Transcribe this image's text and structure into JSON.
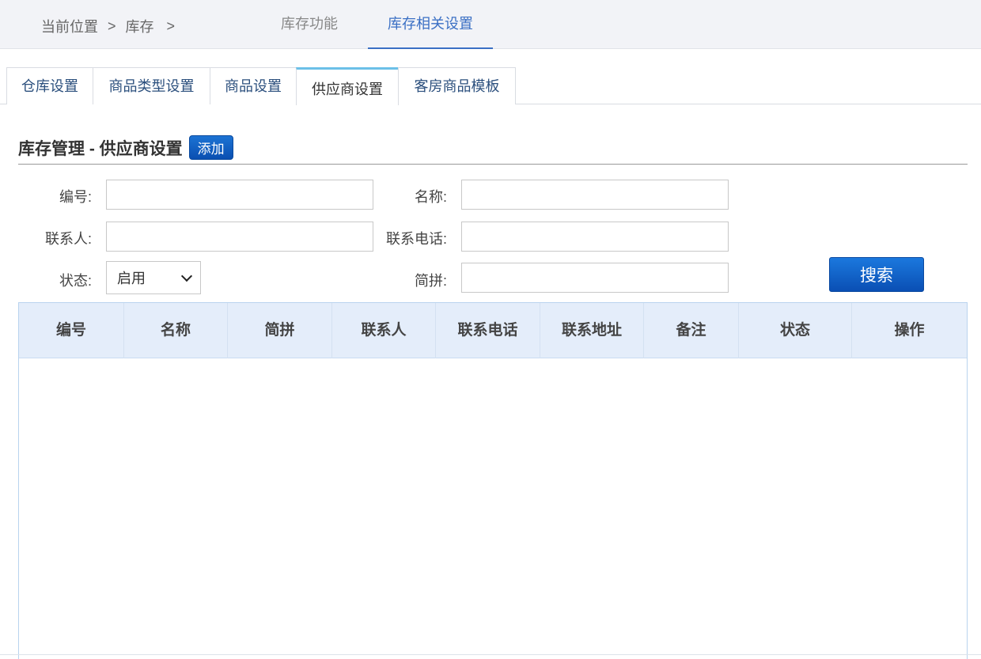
{
  "breadcrumb": {
    "current_label": "当前位置",
    "sep1": ">",
    "item1": "库存",
    "sep2": ">"
  },
  "top_tabs": [
    {
      "label": "库存功能",
      "active": false
    },
    {
      "label": "库存相关设置",
      "active": true
    }
  ],
  "sub_tabs": [
    {
      "label": "仓库设置",
      "active": false
    },
    {
      "label": "商品类型设置",
      "active": false
    },
    {
      "label": "商品设置",
      "active": false
    },
    {
      "label": "供应商设置",
      "active": true
    },
    {
      "label": "客房商品模板",
      "active": false
    }
  ],
  "section": {
    "title": "库存管理 - 供应商设置",
    "add_label": "添加"
  },
  "form": {
    "code_label": "编号:",
    "name_label": "名称:",
    "contact_label": "联系人:",
    "phone_label": "联系电话:",
    "status_label": "状态:",
    "status_value": "启用",
    "pinyin_label": "简拼:",
    "search_label": "搜索"
  },
  "table": {
    "columns": [
      "编号",
      "名称",
      "简拼",
      "联系人",
      "联系电话",
      "联系地址",
      "备注",
      "状态",
      "操作"
    ]
  },
  "colors": {
    "accent": "#3a6fc4",
    "button": "#0a4fb1",
    "table_header": "#e4edfa",
    "active_tab_top": "#6cc0e8"
  }
}
